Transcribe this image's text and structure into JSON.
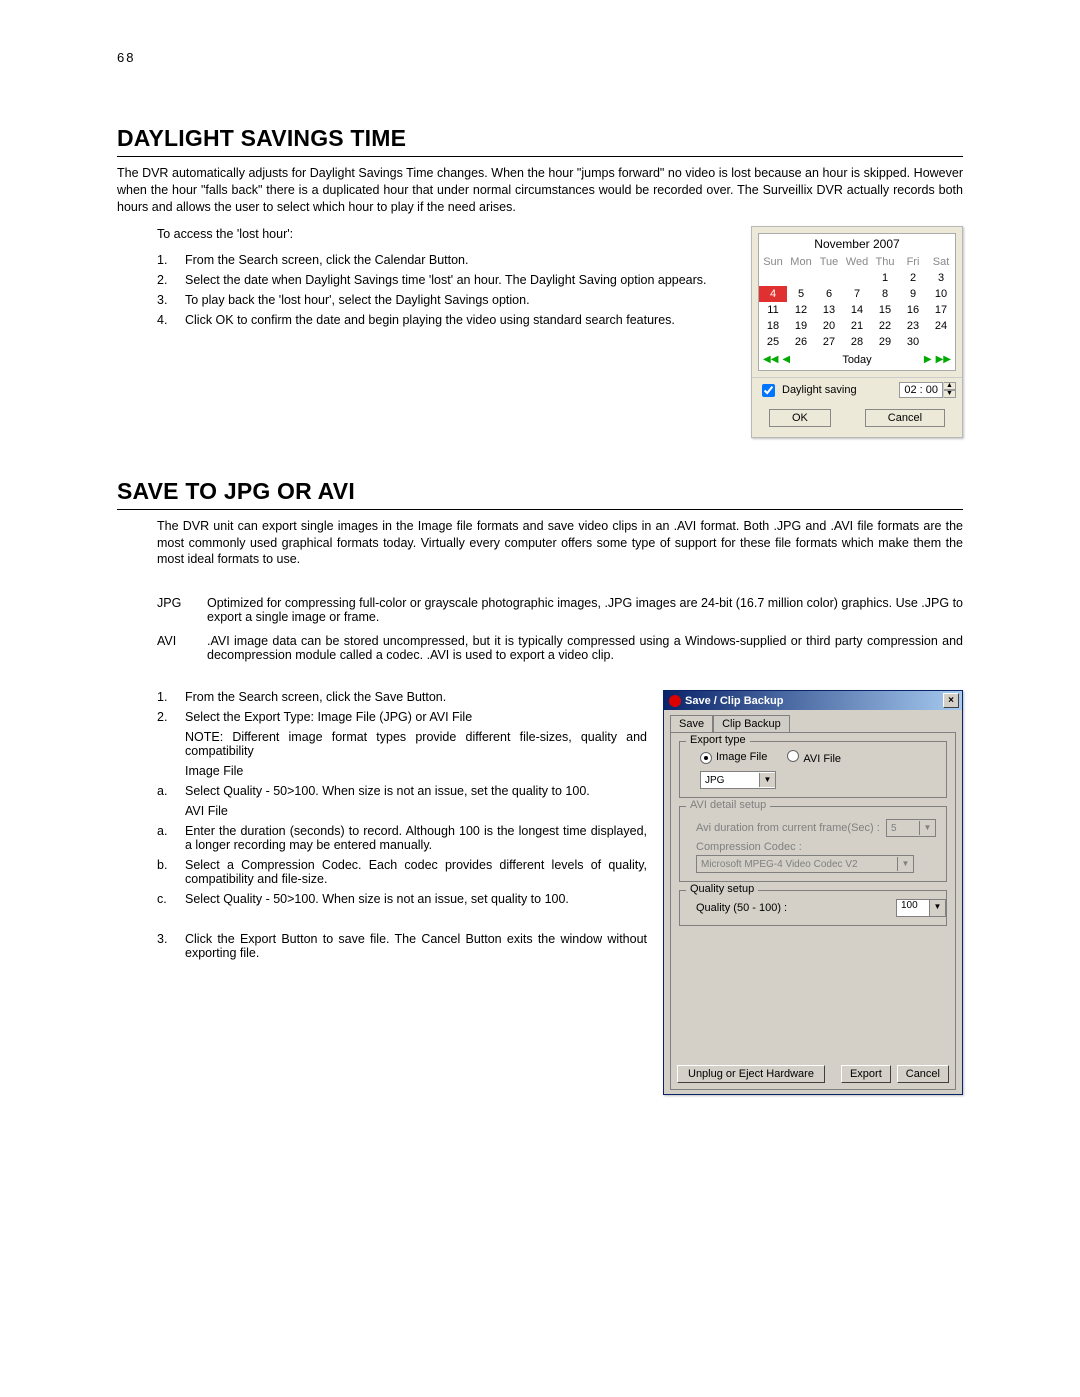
{
  "page_number": "68",
  "section1": {
    "title": "DAYLIGHT SAVINGS TIME",
    "intro": "The DVR automatically adjusts for Daylight Savings Time changes.  When the hour \"jumps forward\" no video is lost because an hour is skipped.  However when the hour \"falls back\" there is a duplicated hour that under normal circumstances would be recorded over.  The Surveillix DVR actually records both hours and allows the user to select which hour to play if the need arises.",
    "access_line": "To access the 'lost hour':",
    "steps": [
      "From the Search screen, click the Calendar Button.",
      "Select the date when Daylight Savings time 'lost' an hour. The Daylight Saving option appears.",
      "To play back the 'lost hour', select the Daylight Savings option.",
      "Click OK to confirm the date and begin playing the video using standard search features."
    ]
  },
  "calendar": {
    "month": "November 2007",
    "days": [
      "Sun",
      "Mon",
      "Tue",
      "Wed",
      "Thu",
      "Fri",
      "Sat"
    ],
    "weeks": [
      [
        "",
        "",
        "",
        "1",
        "2",
        "3",
        "",
        ""
      ],
      [
        "4",
        "5",
        "6",
        "7",
        "8",
        "9",
        "10"
      ],
      [
        "11",
        "12",
        "13",
        "14",
        "15",
        "16",
        "17"
      ],
      [
        "18",
        "19",
        "20",
        "21",
        "22",
        "23",
        "24"
      ],
      [
        "25",
        "26",
        "27",
        "28",
        "29",
        "30",
        ""
      ]
    ],
    "selected": "4",
    "today_label": "Today",
    "daylight_label": "Daylight saving",
    "time_value": "02 : 00",
    "ok": "OK",
    "cancel": "Cancel"
  },
  "section2": {
    "title": "SAVE TO JPG OR AVI",
    "intro": "The DVR unit can export single images in the Image file formats and save video clips in an .AVI format.  Both .JPG and .AVI file formats are the most commonly used graphical formats today.  Virtually every computer offers some type of support for these file formats which make them the most ideal formats to use.",
    "jpg_label": "JPG",
    "jpg_def": "Optimized for compressing full-color or grayscale photographic images, .JPG images are 24-bit (16.7 million color) graphics. Use .JPG to export a single image or frame.",
    "avi_label": "AVI",
    "avi_def": ".AVI image data can be stored uncompressed, but it is typically compressed using a Windows-supplied or third party compression and decompression module called a codec.  .AVI is used to export a video clip.",
    "steps": [
      "From the Search screen, click  the Save Button.",
      "Select the Export Type: Image File (JPG) or AVI File"
    ],
    "note": "NOTE: Different image format types provide different file-sizes, quality and compatibility",
    "image_file_label": "Image File",
    "image_file_a": "Select Quality  - 50>100.  When size is not an issue, set the quality to 100.",
    "avi_file_label": "AVI File",
    "avi_file_a": "Enter the duration (seconds) to record.  Although 100 is the longest time displayed, a longer recording may be entered manually.",
    "avi_file_b": "Select a Compression Codec.  Each codec provides different levels of quality, compatibility and file-size.",
    "avi_file_c": "Select Quality  - 50>100.  When size is not an issue, set quality to 100.",
    "step3": "Click the Export Button to save file.  The Cancel Button exits the window without exporting file."
  },
  "dialog": {
    "title": "Save / Clip Backup",
    "tab_save": "Save",
    "tab_clipbackup": "Clip Backup",
    "export_type": "Export type",
    "radio_image": "Image File",
    "radio_avi": "AVI File",
    "format_value": "JPG",
    "avi_group": "AVI detail setup",
    "avi_duration_label": "Avi duration from current frame(Sec) :",
    "avi_duration_value": "5",
    "avi_codec_label": "Compression Codec :",
    "avi_codec_value": "Microsoft MPEG-4 Video Codec V2",
    "quality_group": "Quality setup",
    "quality_label": "Quality (50 - 100) :",
    "quality_value": "100",
    "btn_unplug": "Unplug or Eject Hardware",
    "btn_export": "Export",
    "btn_cancel": "Cancel"
  }
}
